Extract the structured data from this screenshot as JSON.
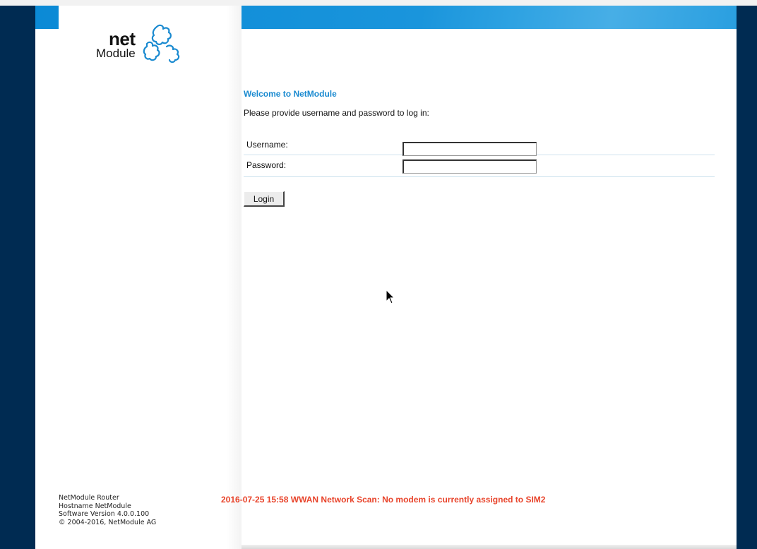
{
  "brand": {
    "logo_net": "net",
    "logo_module": "Module"
  },
  "login": {
    "welcome": "Welcome to NetModule",
    "instruction": "Please provide username and password to log in:",
    "username_label": "Username:",
    "username_value": "",
    "password_label": "Password:",
    "password_value": "",
    "login_button": "Login"
  },
  "footer": {
    "line1": "NetModule Router",
    "line2": "Hostname NetModule",
    "line3": "Software Version 4.0.0.100",
    "line4": "© 2004-2016, NetModule AG"
  },
  "status": {
    "message": "2016-07-25 15:58  WWAN Network Scan: No modem is currently assigned to SIM2"
  },
  "colors": {
    "frame": "#002b52",
    "header": "#1a95dc",
    "welcome": "#1a8ad0",
    "status": "#e8432a"
  }
}
